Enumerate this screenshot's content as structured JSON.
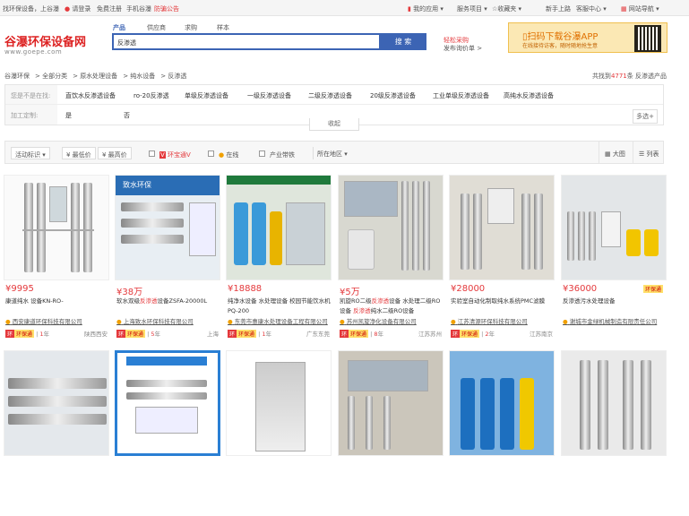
{
  "topbar": {
    "find": "找环保设备，上谷瀑",
    "login": "请登录",
    "register": "免费注册",
    "mobile": "手机谷瀑",
    "notice": "防骗公告",
    "myapp": "我的应用",
    "service": "服务项目",
    "favorite": "收藏夹",
    "newbie": "新手上路",
    "support": "客服中心",
    "sitenav": "网站导航"
  },
  "header": {
    "logo": "谷瀑环保设备网",
    "logo_sub": "www.goepe.com",
    "search_tabs": [
      "产品",
      "供应商",
      "求购",
      "样本"
    ],
    "search_value": "反渗透",
    "search_button": "搜 索",
    "qg_title": "轻松采购",
    "qg_link": "发布询价单 >",
    "app_title": "扫码下载谷瀑APP",
    "app_sub": "在线接待访客，随时随地抢生意"
  },
  "breadcrumb": [
    "谷瀑环保",
    "全部分类",
    "原水处理设备",
    "纯水设备",
    "反渗透"
  ],
  "result_count": {
    "prefix": "共找到",
    "number": "4771",
    "suffix": "条 反渗透产品"
  },
  "filters": {
    "type_label": "您是不是在找:",
    "type_items": [
      "直饮水反渗透设备",
      "ro-20反渗透",
      "单级反渗透设备",
      "一级反渗透设备",
      "二级反渗透设备",
      "20级反渗透设备",
      "工业单级反渗透设备",
      "高纯水反渗透设备"
    ],
    "custom_label": "加工定制:",
    "custom_items": [
      "是",
      "否"
    ],
    "more": "多选+",
    "collapse": "收起"
  },
  "sortbar": {
    "active": "活动标识",
    "price_low": "¥ 最低价",
    "price_high": "¥ 最高价",
    "huanbao": "环宝通V",
    "online": "在线",
    "guarantee": "产业带铁",
    "region": "所在地区",
    "view_grid": "大图",
    "view_list": "列表"
  },
  "products": [
    {
      "price": "¥9995",
      "title": "康道纯水 设备KN-RO-",
      "company": "西安康道环保科技有限公司",
      "years": "1",
      "city": "陕西西安"
    },
    {
      "price": "¥38万",
      "title": "软水双级反渗透设备ZSFA-20000L",
      "company": "上海致水环保科技有限公司",
      "years": "5",
      "city": "上海"
    },
    {
      "price": "¥18888",
      "title": "纯净水设备 水处理设备 校园节能饮水机PQ-200",
      "company": "东莞市惠康水处理设备工程有限公司",
      "years": "1",
      "city": "广东东莞"
    },
    {
      "price": "¥5万",
      "title": "凯旋RO二级反渗透设备 水处理二级RO设备 反渗透纯水二级RO设备",
      "company": "苏州凯旋净化设备有限公司",
      "years": "8",
      "city": "江苏苏州"
    },
    {
      "price": "¥28000",
      "title": "实验室自动化制取纯水系统PMC滤膜",
      "company": "江苏清源环保科技有限公司",
      "years": "2",
      "city": "江苏南京"
    },
    {
      "price": "¥36000",
      "title": "反渗透污水处理设备",
      "company": "谢城市金绿机械制造有限责任公司",
      "years": "",
      "city": ""
    }
  ]
}
